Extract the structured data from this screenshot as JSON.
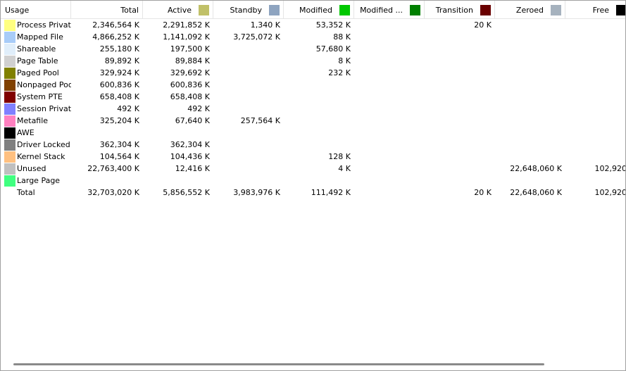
{
  "columns": [
    {
      "label": "Usage"
    },
    {
      "label": "Total"
    },
    {
      "label": "Active",
      "color": "#c0c068"
    },
    {
      "label": "Standby",
      "color": "#8ea4c0"
    },
    {
      "label": "Modified",
      "color": "#00c800"
    },
    {
      "label": "Modified ...",
      "color": "#008000"
    },
    {
      "label": "Transition",
      "color": "#6a0000"
    },
    {
      "label": "Zeroed",
      "color": "#a6b2be"
    },
    {
      "label": "Free",
      "color": "#000000"
    }
  ],
  "rows": [
    {
      "label": "Process Private",
      "color": "#ffff80",
      "values": [
        "2,346,564 K",
        "2,291,852 K",
        "1,340 K",
        "53,352 K",
        "",
        "20 K",
        "",
        ""
      ]
    },
    {
      "label": "Mapped File",
      "color": "#a8ccf8",
      "values": [
        "4,866,252 K",
        "1,141,092 K",
        "3,725,072 K",
        "88 K",
        "",
        "",
        "",
        ""
      ]
    },
    {
      "label": "Shareable",
      "color": "#e0eefa",
      "values": [
        "255,180 K",
        "197,500 K",
        "",
        "57,680 K",
        "",
        "",
        "",
        ""
      ]
    },
    {
      "label": "Page Table",
      "color": "#d0d0d0",
      "values": [
        "89,892 K",
        "89,884 K",
        "",
        "8 K",
        "",
        "",
        "",
        ""
      ]
    },
    {
      "label": "Paged Pool",
      "color": "#808000",
      "values": [
        "329,924 K",
        "329,692 K",
        "",
        "232 K",
        "",
        "",
        "",
        ""
      ]
    },
    {
      "label": "Nonpaged Pool",
      "color": "#804000",
      "values": [
        "600,836 K",
        "600,836 K",
        "",
        "",
        "",
        "",
        "",
        ""
      ]
    },
    {
      "label": "System PTE",
      "color": "#800000",
      "values": [
        "658,408 K",
        "658,408 K",
        "",
        "",
        "",
        "",
        "",
        ""
      ]
    },
    {
      "label": "Session Private",
      "color": "#8080ff",
      "values": [
        "492 K",
        "492 K",
        "",
        "",
        "",
        "",
        "",
        ""
      ]
    },
    {
      "label": "Metafile",
      "color": "#ff80c0",
      "values": [
        "325,204 K",
        "67,640 K",
        "257,564 K",
        "",
        "",
        "",
        "",
        ""
      ]
    },
    {
      "label": "AWE",
      "color": "#000000",
      "values": [
        "",
        "",
        "",
        "",
        "",
        "",
        "",
        ""
      ]
    },
    {
      "label": "Driver Locked",
      "color": "#808080",
      "values": [
        "362,304 K",
        "362,304 K",
        "",
        "",
        "",
        "",
        "",
        ""
      ]
    },
    {
      "label": "Kernel Stack",
      "color": "#ffc080",
      "values": [
        "104,564 K",
        "104,436 K",
        "",
        "128 K",
        "",
        "",
        "",
        ""
      ]
    },
    {
      "label": "Unused",
      "color": "#c0c0c0",
      "values": [
        "22,763,400 K",
        "12,416 K",
        "",
        "4 K",
        "",
        "",
        "22,648,060 K",
        "102,920"
      ]
    },
    {
      "label": "Large Page",
      "color": "#40ff80",
      "values": [
        "",
        "",
        "",
        "",
        "",
        "",
        "",
        ""
      ]
    },
    {
      "label": "Total",
      "color": "",
      "values": [
        "32,703,020 K",
        "5,856,552 K",
        "3,983,976 K",
        "111,492 K",
        "",
        "20 K",
        "22,648,060 K",
        "102,920"
      ]
    }
  ]
}
